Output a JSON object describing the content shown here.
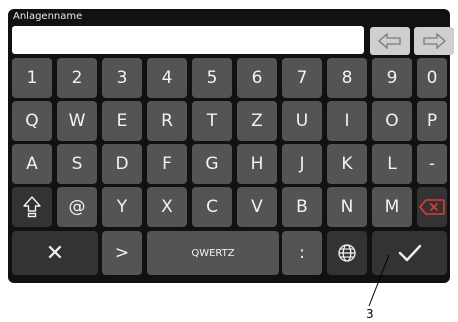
{
  "field": {
    "title": "Anlagenname",
    "value": ""
  },
  "nav": {
    "left_icon": "arrow-left-outline-icon",
    "right_icon": "arrow-right-outline-icon"
  },
  "keyboard": {
    "row_numbers": [
      "1",
      "2",
      "3",
      "4",
      "5",
      "6",
      "7",
      "8",
      "9",
      "0"
    ],
    "row_qwertz": [
      "Q",
      "W",
      "E",
      "R",
      "T",
      "Z",
      "U",
      "I",
      "O",
      "P"
    ],
    "row_asdf": [
      "A",
      "S",
      "D",
      "F",
      "G",
      "H",
      "J",
      "K",
      "L",
      "-"
    ],
    "row_yxcv": [
      "@",
      "Y",
      "X",
      "C",
      "V",
      "B",
      "N",
      "M"
    ],
    "shift_icon": "shift-arrow-up-icon",
    "backspace_icon": "backspace-icon",
    "cancel_symbol": "✕",
    "greater_key": ">",
    "layout_label": "QWERTZ",
    "colon_key": ":",
    "globe_icon": "globe-icon",
    "confirm_icon": "checkmark-icon"
  },
  "callout": {
    "number": "3"
  },
  "colors": {
    "screen_bg": "#111111",
    "key_bg": "#545454",
    "special_key_bg": "#333333",
    "accent_red": "#e53935"
  }
}
